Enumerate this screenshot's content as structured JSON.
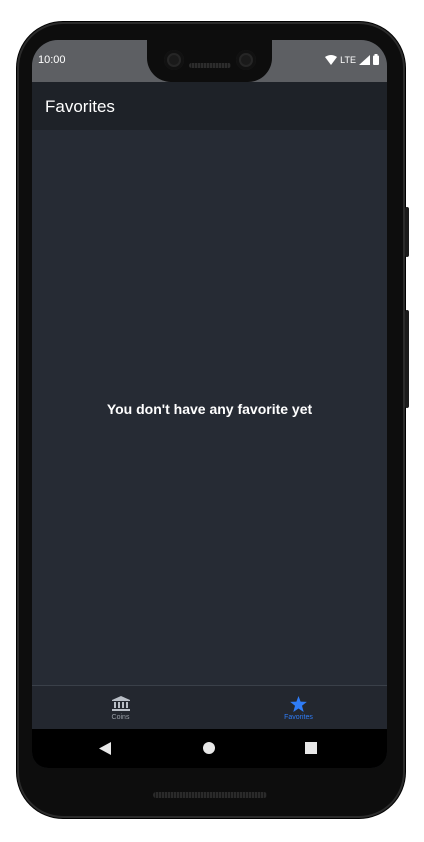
{
  "status_bar": {
    "time": "10:00",
    "network": "LTE"
  },
  "header": {
    "title": "Favorites"
  },
  "main": {
    "empty_message": "You don't have any favorite yet"
  },
  "tab_bar": {
    "tabs": [
      {
        "label": "Coins",
        "icon": "bank-icon",
        "active": false,
        "color": "#9aa0a8"
      },
      {
        "label": "Favorites",
        "icon": "star-icon",
        "active": true,
        "color": "#2f7cf6"
      }
    ]
  },
  "colors": {
    "screen_background": "#262b34",
    "header_background": "#1e2228",
    "accent": "#2f7cf6"
  }
}
